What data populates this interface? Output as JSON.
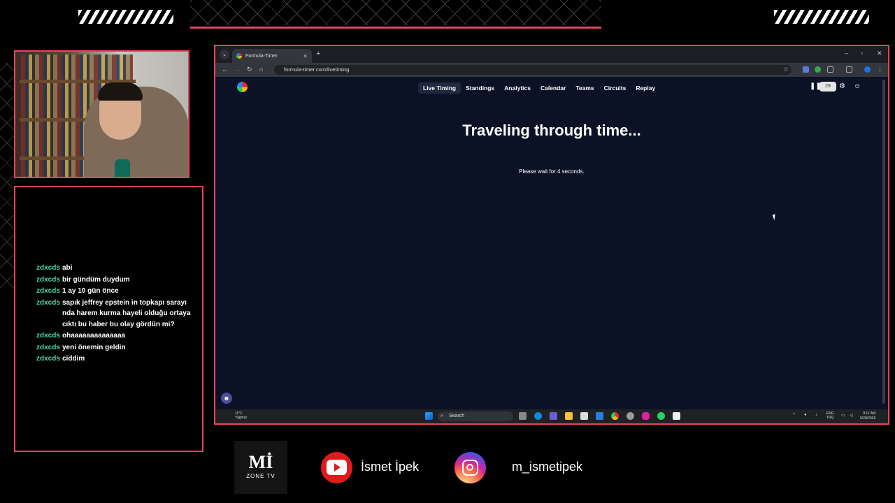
{
  "overlay": {
    "youtube_name": "İsmet İpek",
    "instagram_handle": "m_ismetipek",
    "logo_text": "Mİ",
    "logo_sub": "ZONE TV",
    "accent_color": "#e8435f"
  },
  "chat": {
    "messages": [
      {
        "user": "zdxcds",
        "text": "abi"
      },
      {
        "user": "zdxcds",
        "text": "bir gündüm duydum"
      },
      {
        "user": "zdxcds",
        "text": "1 ay 10 gün önce"
      },
      {
        "user": "zdxcds",
        "text": "sapık jeffrey epstein in topkapı sarayı nda harem kurma hayeli olduğu ortaya cıktı bu haber bu olay gördün mi?"
      },
      {
        "user": "zdxcds",
        "text": "ohaaaaaaaaaaaaaa"
      },
      {
        "user": "zdxcds",
        "text": "yeni önemin geldin"
      },
      {
        "user": "zdxcds",
        "text": "ciddim"
      }
    ]
  },
  "browser": {
    "tab_title": "Formula-Timer",
    "url": "formula-timer.com/livetiming"
  },
  "site": {
    "nav": [
      "Live Timing",
      "Standings",
      "Analytics",
      "Calendar",
      "Teams",
      "Circuits",
      "Replay"
    ],
    "active_nav": "Live Timing",
    "delay_value": "29",
    "heading": "Traveling through time...",
    "subtext": "Please wait for 4 seconds."
  },
  "taskbar": {
    "temperature": "11°C",
    "weather": "Yağmur",
    "search_label": "Search",
    "lang_top": "ENG",
    "lang_bottom": "TRQ",
    "time": "9:11 AM",
    "date": "5/28/2026"
  }
}
